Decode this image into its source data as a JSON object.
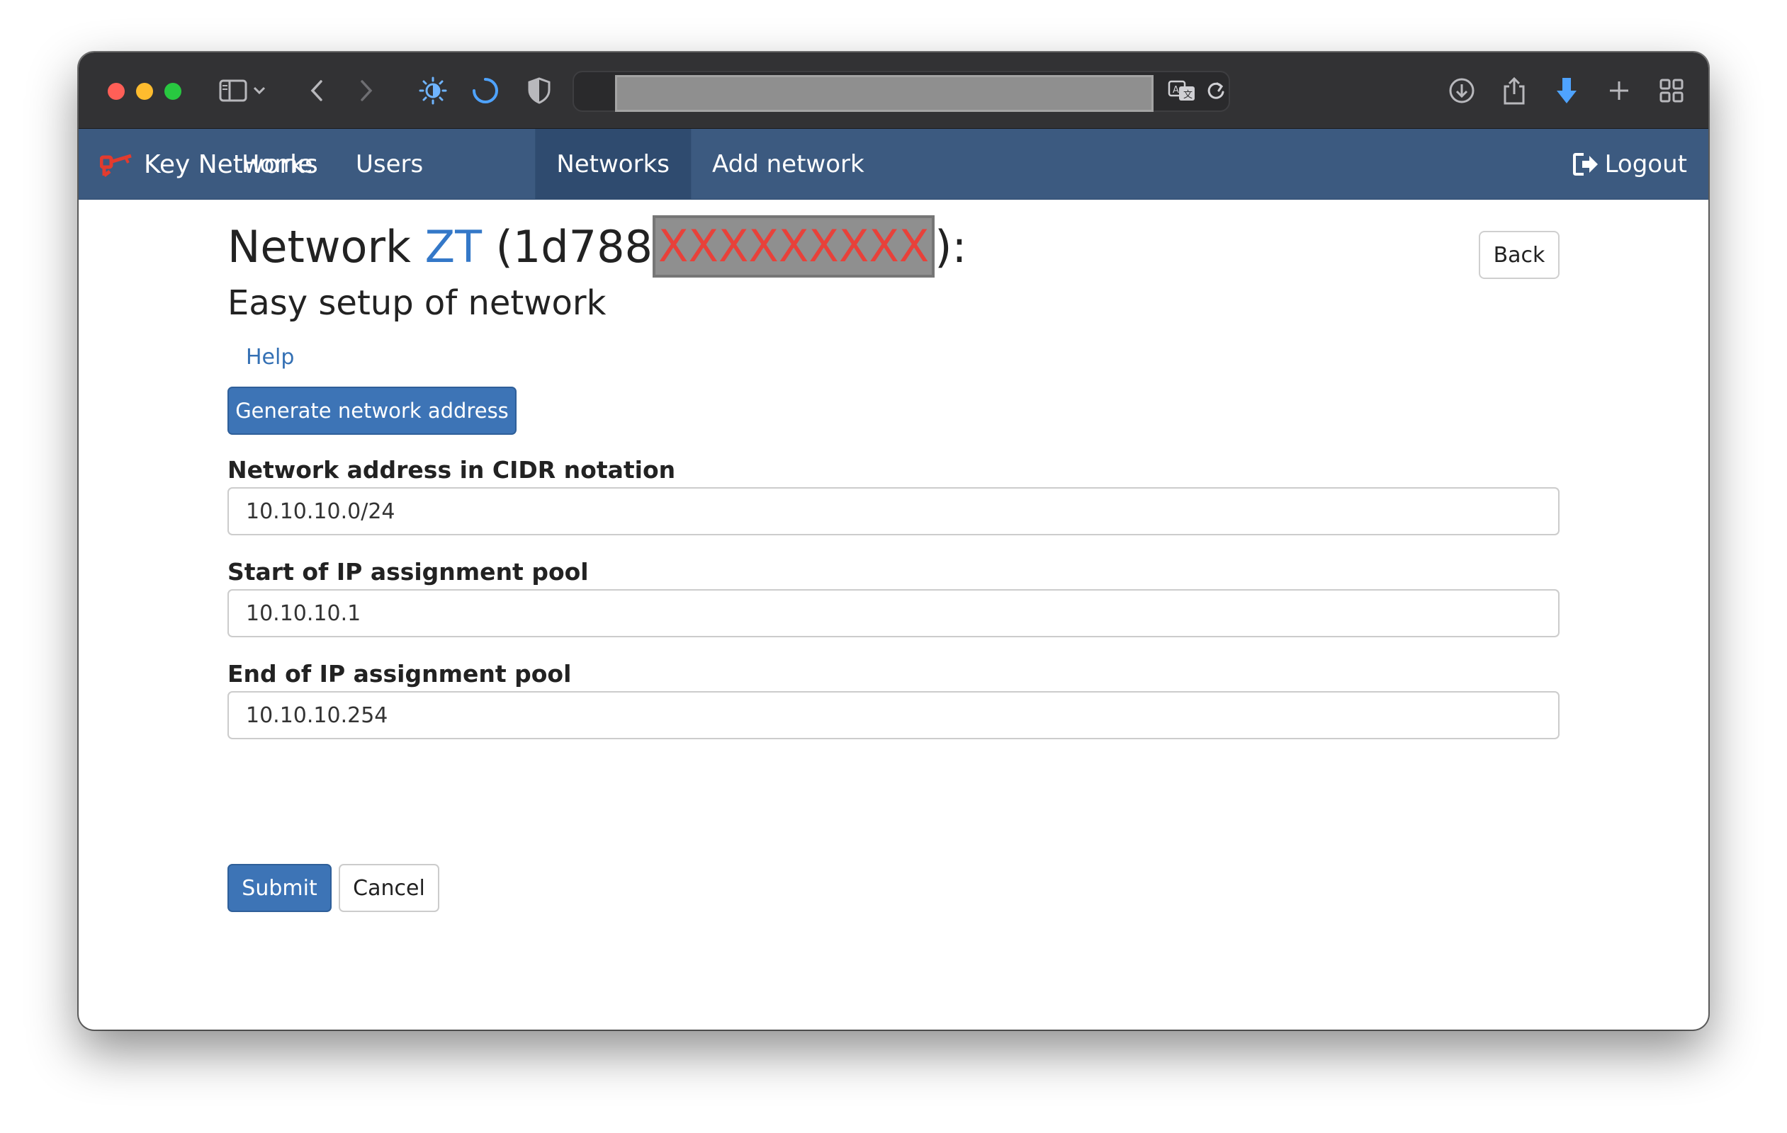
{
  "browser": {
    "toolbar_icons": [
      "sidebar-icon",
      "chevron-down-icon",
      "back-arrow-icon",
      "forward-arrow-icon",
      "brightness-icon",
      "loading-spinner-icon",
      "shield-icon",
      "translate-icon",
      "reload-icon",
      "download-circle-icon",
      "share-icon",
      "download-arrow-icon",
      "plus-icon",
      "tab-grid-icon"
    ]
  },
  "navbar": {
    "brand": "Key Networks",
    "items": [
      {
        "label": "Home"
      },
      {
        "label": "Users"
      },
      {
        "label": "Networks",
        "active": true
      },
      {
        "label": "Add network"
      }
    ],
    "logout": "Logout",
    "brand_color": "#e33b2e",
    "bg_color": "#3c5a80"
  },
  "page": {
    "title_prefix": "Network",
    "network_name": "ZT",
    "id_open": "(1d788",
    "id_redacted": "XXXXXXXXX",
    "id_close": "):",
    "back": "Back",
    "subtitle": "Easy setup of network",
    "help": "Help",
    "generate": "Generate network address",
    "fields": [
      {
        "label": "Network address in CIDR notation",
        "value": "10.10.10.0/24"
      },
      {
        "label": "Start of IP assignment pool",
        "value": "10.10.10.1"
      },
      {
        "label": "End of IP assignment pool",
        "value": "10.10.10.254"
      }
    ],
    "submit": "Submit",
    "cancel": "Cancel",
    "primary_color": "#3d74b6"
  }
}
